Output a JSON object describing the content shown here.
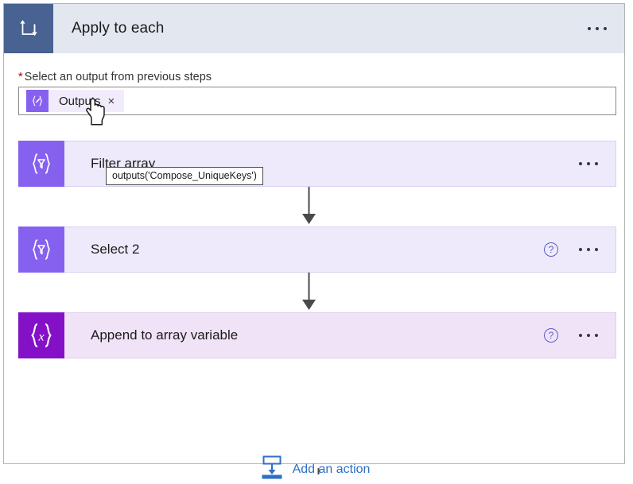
{
  "scope": {
    "title": "Apply to each",
    "icon": "loop-icon",
    "header_bg": "#e3e7ef",
    "icon_bg": "#486291",
    "more_label": "..."
  },
  "field": {
    "required_marker": "*",
    "label": "Select an output from previous steps",
    "token": {
      "icon": "compose-token-icon",
      "label": "Outputs",
      "close_label": "×",
      "icon_bg": "#8661f0",
      "chip_bg": "#f1ebfb"
    },
    "tooltip": "outputs('Compose_UniqueKeys')"
  },
  "actions": [
    {
      "title": "Filter array",
      "icon": "filter-array-icon",
      "icon_bg": "#8661f0",
      "card_bg": "#eeeafb",
      "has_help": false,
      "help_label": "?",
      "more_label": "..."
    },
    {
      "title": "Select 2",
      "icon": "select-array-icon",
      "icon_bg": "#8661f0",
      "card_bg": "#eeeafb",
      "has_help": true,
      "help_label": "?",
      "more_label": "..."
    },
    {
      "title": "Append to array variable",
      "icon": "variable-x-icon",
      "icon_bg": "#8411c7",
      "card_bg": "#f0e3f7",
      "has_help": true,
      "help_label": "?",
      "more_label": "..."
    }
  ],
  "add_action": {
    "label": "Add an action",
    "icon": "insert-action-icon",
    "color": "#2f6fc4"
  },
  "cursor": {
    "type": "pointing-hand-cursor"
  }
}
